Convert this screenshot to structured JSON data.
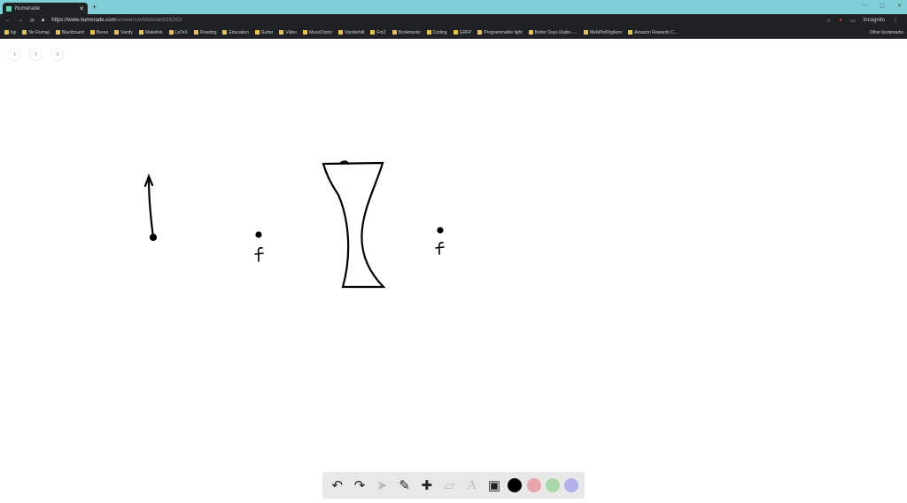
{
  "browser": {
    "tab_title": "Numerade",
    "url_host": "https://www.numerade.com",
    "url_path": "/answers/whiteboard/26282/",
    "incognito": "Incognito",
    "bookmarks": [
      "fuji",
      "No Romaji",
      "Blackboard",
      "Berea",
      "Vandy",
      "Makelink",
      "LaTeX",
      "Reading",
      "Education",
      "Guitar",
      "Video",
      "MusicDistro",
      "Vanderbilt",
      "FotZ",
      "Bookmarks",
      "Coding",
      "GRFP",
      "Programmable light",
      "Better Days Radio -...",
      "WebPlotDigitizer",
      "Amazon Rewards C..."
    ],
    "other_bookmarks": "Other bookmarks"
  },
  "pages": [
    "1",
    "2",
    "3"
  ],
  "toolbar": {
    "undo": "↶",
    "redo": "↷",
    "select": "➤",
    "pen": "✎",
    "add": "✚",
    "eraser": "▱",
    "text": "A",
    "image": "▣",
    "colors": [
      "#000000",
      "#e8a5ae",
      "#a9d8a9",
      "#b4b0ec"
    ]
  }
}
